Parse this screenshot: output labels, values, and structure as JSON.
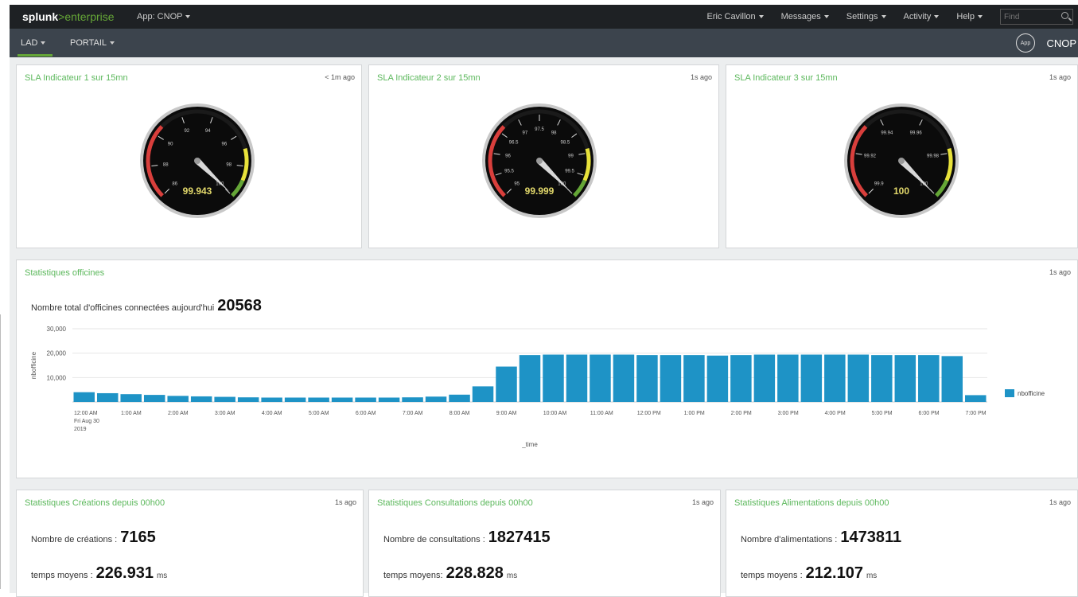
{
  "topbar": {
    "logo_brand": "splunk",
    "logo_gt": ">",
    "logo_product": "enterprise",
    "app_menu": "App: CNOP",
    "nav": [
      "Eric Cavillon",
      "Messages",
      "Settings",
      "Activity",
      "Help"
    ],
    "search_placeholder": "Find"
  },
  "appbar": {
    "nav": [
      "LAD",
      "PORTAIL"
    ],
    "app_badge": "App",
    "app_name": "CNOP"
  },
  "gauges": [
    {
      "title": "SLA Indicateur 1 sur 15mn",
      "time": "< 1m ago",
      "value": "99.943",
      "ticks": [
        "86",
        "88",
        "90",
        "92",
        "94",
        "96",
        "98",
        "100"
      ],
      "min": 86,
      "max": 100,
      "current": 99.943
    },
    {
      "title": "SLA Indicateur 2 sur 15mn",
      "time": "1s ago",
      "value": "99.999",
      "ticks": [
        "95",
        "95.5",
        "96",
        "96.5",
        "97",
        "97.5",
        "98",
        "98.5",
        "99",
        "99.5",
        "100"
      ],
      "min": 95,
      "max": 100,
      "current": 99.999
    },
    {
      "title": "SLA Indicateur 3 sur 15mn",
      "time": "1s ago",
      "value": "100",
      "ticks": [
        "99.9",
        "99.92",
        "99.94",
        "99.96",
        "99.98",
        "100"
      ],
      "min": 99.9,
      "max": 100,
      "current": 100
    }
  ],
  "stats_panel": {
    "title": "Statistiques officines",
    "time": "1s ago",
    "total_label": "Nombre total d'officines connectées aujourd'hui",
    "total_value": "20568"
  },
  "chart_data": {
    "type": "bar",
    "title": "",
    "xlabel": "_time",
    "ylabel": "nbofficine",
    "ylim": [
      0,
      30000
    ],
    "yticks": [
      "10,000",
      "20,000",
      "30,000"
    ],
    "grid": true,
    "legend": "right",
    "x_tick_labels": [
      "12:00 AM",
      "1:00 AM",
      "2:00 AM",
      "3:00 AM",
      "4:00 AM",
      "5:00 AM",
      "6:00 AM",
      "7:00 AM",
      "8:00 AM",
      "9:00 AM",
      "10:00 AM",
      "11:00 AM",
      "12:00 PM",
      "1:00 PM",
      "2:00 PM",
      "3:00 PM",
      "4:00 PM",
      "5:00 PM",
      "6:00 PM",
      "7:00 PM"
    ],
    "x_date_sublabel": [
      "Fri Aug 30",
      "2019"
    ],
    "series": [
      {
        "name": "nbofficine",
        "color": "#1e93c6",
        "values": [
          4000,
          3600,
          3200,
          2900,
          2500,
          2300,
          2100,
          1900,
          1800,
          1800,
          1800,
          1800,
          1800,
          1800,
          1900,
          2200,
          3000,
          6400,
          14500,
          19200,
          19400,
          19400,
          19400,
          19400,
          19200,
          19200,
          19200,
          19000,
          19200,
          19400,
          19400,
          19400,
          19400,
          19400,
          19200,
          19200,
          19200,
          18800,
          2800
        ]
      }
    ]
  },
  "bottom_panels": [
    {
      "title": "Statistiques Créations depuis 00h00",
      "time": "1s ago",
      "count_label": "Nombre de créations :",
      "count_value": "7165",
      "avg_label": "temps moyens :",
      "avg_value": "226.931",
      "unit": "ms"
    },
    {
      "title": "Statistiques Consultations depuis 00h00",
      "time": "1s ago",
      "count_label": "Nombre de consultations :",
      "count_value": "1827415",
      "avg_label": "temps moyens:",
      "avg_value": "228.828",
      "unit": "ms"
    },
    {
      "title": "Statistiques Alimentations depuis 00h00",
      "time": "1s ago",
      "count_label": "Nombre d'alimentations :",
      "count_value": "1473811",
      "avg_label": "temps moyens :",
      "avg_value": "212.107",
      "unit": "ms"
    }
  ]
}
